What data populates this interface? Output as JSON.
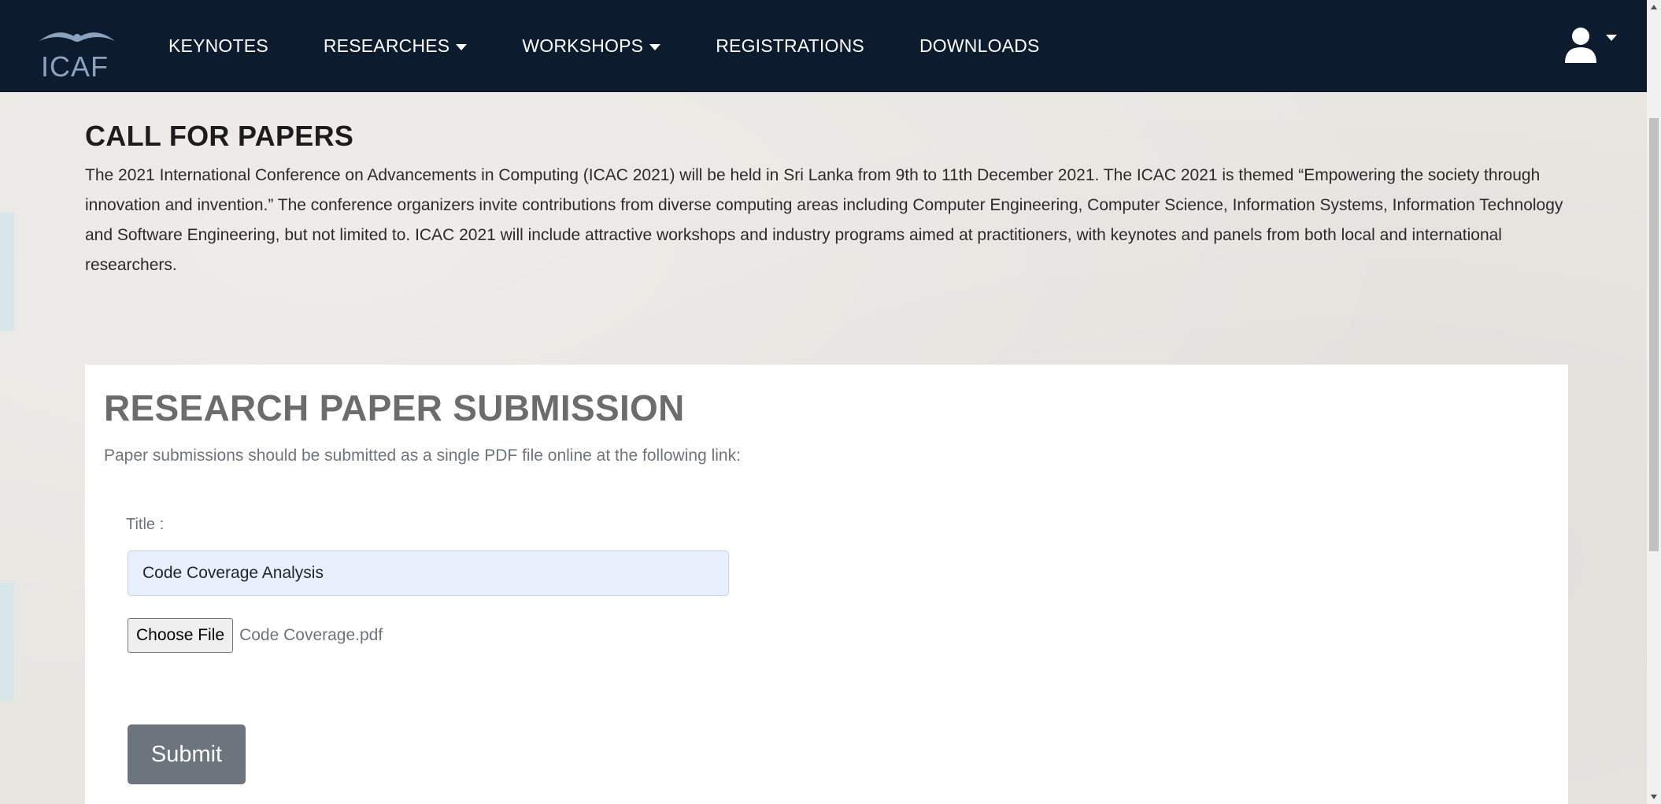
{
  "navbar": {
    "brand": "ICAF",
    "items": [
      {
        "label": "KEYNOTES",
        "has_dropdown": false
      },
      {
        "label": "RESEARCHES",
        "has_dropdown": true
      },
      {
        "label": "WORKSHOPS",
        "has_dropdown": true
      },
      {
        "label": "REGISTRATIONS",
        "has_dropdown": false
      },
      {
        "label": "DOWNLOADS",
        "has_dropdown": false
      }
    ],
    "user_icon": "user-icon",
    "background_color": "#0d1b2e"
  },
  "call_for_papers": {
    "heading": "CALL FOR PAPERS",
    "body": "The 2021 International Conference on Advancements in Computing (ICAC 2021) will be held in Sri Lanka from 9th to 11th December 2021. The ICAC 2021 is themed “Empowering the society through innovation and invention.” The conference organizers invite contributions from diverse computing areas including Computer Engineering, Computer Science, Information Systems, Information Technology and Software Engineering, but not limited to. ICAC 2021 will include attractive workshops and industry programs aimed at practitioners, with keynotes and panels from both local and international researchers."
  },
  "submission": {
    "heading": "RESEARCH PAPER SUBMISSION",
    "subtitle": "Paper submissions should be submitted as a single PDF file online at the following link:",
    "title_label": "Title :",
    "title_value": "Code Coverage Analysis",
    "choose_file_label": "Choose File",
    "file_name": "Code Coverage.pdf",
    "submit_label": "Submit",
    "submit_color": "#6c757d"
  }
}
